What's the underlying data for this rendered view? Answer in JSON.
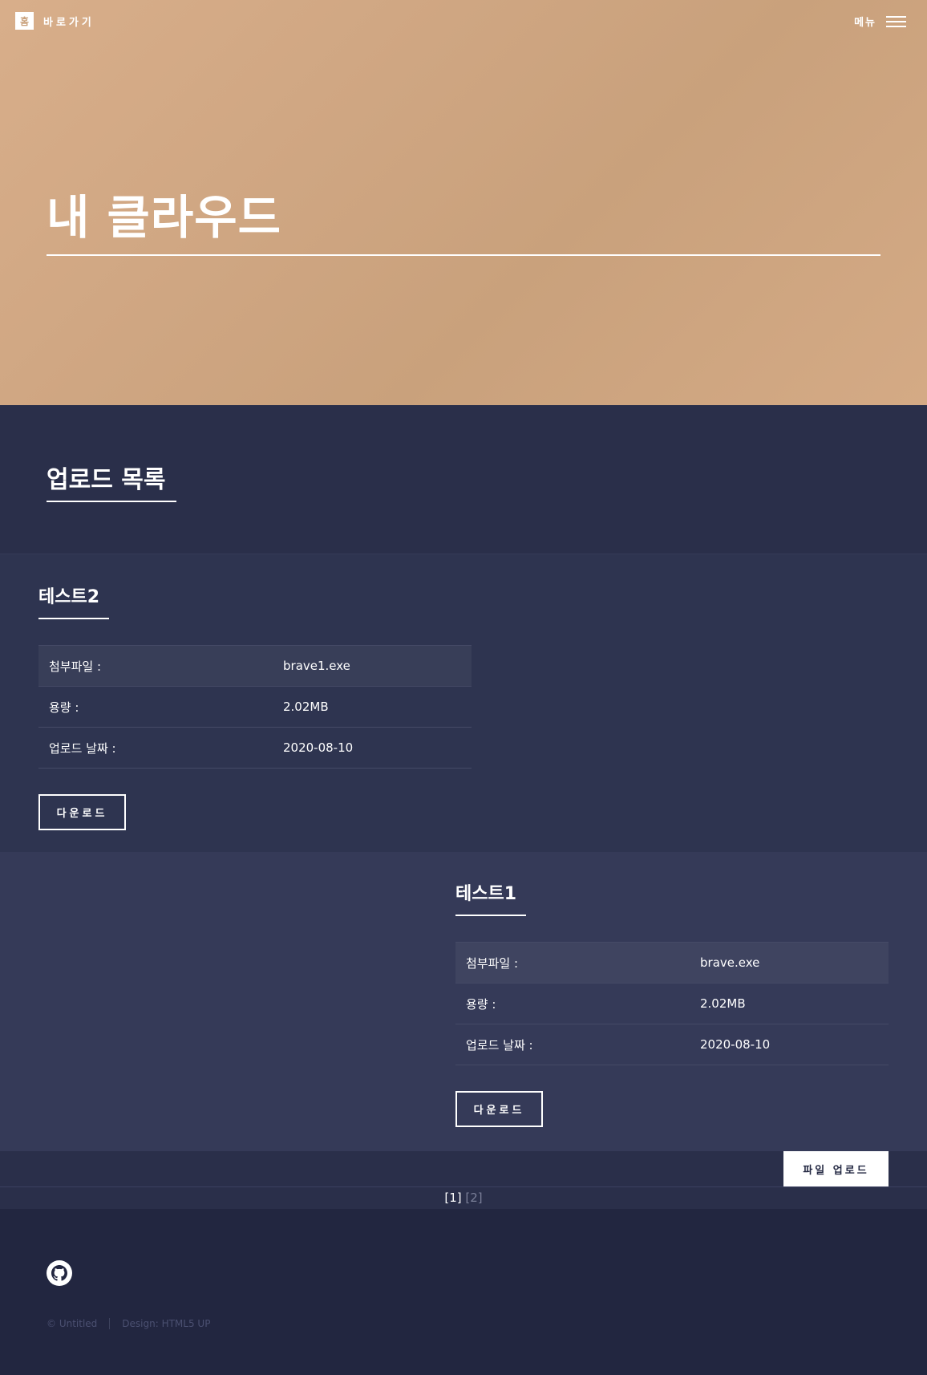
{
  "header": {
    "logo_glyph": "홈",
    "logo_label": "바로가기",
    "menu_label": "메뉴"
  },
  "banner": {
    "title": "내 클라우드"
  },
  "section": {
    "title": "업로드 목록"
  },
  "files": [
    {
      "title": "테스트2",
      "rows": [
        {
          "label": "첨부파일 :",
          "value": "brave1.exe"
        },
        {
          "label": "용량 :",
          "value": "2.02MB"
        },
        {
          "label": "업로드 날짜 :",
          "value": "2020-08-10"
        }
      ],
      "button": "다운로드"
    },
    {
      "title": "테스트1",
      "rows": [
        {
          "label": "첨부파일 :",
          "value": "brave.exe"
        },
        {
          "label": "용량 :",
          "value": "2.02MB"
        },
        {
          "label": "업로드 날짜 :",
          "value": "2020-08-10"
        }
      ],
      "button": "다운로드"
    }
  ],
  "upload_button": "파일 업로드",
  "pagination": {
    "current": "[1]",
    "pages": [
      "[2]"
    ]
  },
  "footer": {
    "icon": "github-icon",
    "copyright": "© Untitled",
    "design": "Design: HTML5 UP"
  },
  "colors": {
    "banner": "#cfa682",
    "background": "#242943",
    "accent": "#ffffff"
  }
}
